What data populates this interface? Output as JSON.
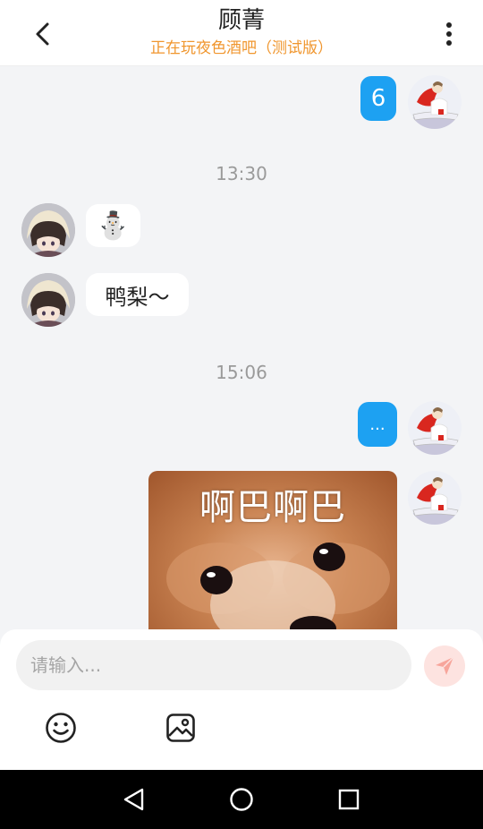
{
  "header": {
    "title": "顾菁",
    "subtitle": "正在玩夜色酒吧（测试版）",
    "back_icon": "chevron-left-icon",
    "more_icon": "more-vertical-icon"
  },
  "messages": {
    "m1": {
      "text": "6",
      "sender": "self"
    },
    "time1": "13:30",
    "m2": {
      "text": "⛄",
      "sender": "friend"
    },
    "m3": {
      "text": "鸭梨～",
      "sender": "friend"
    },
    "time2": "15:06",
    "m4": {
      "text": "...",
      "sender": "self"
    },
    "m5": {
      "sticker_text": "啊巴啊巴",
      "sender": "self"
    }
  },
  "input": {
    "placeholder": "请输入..."
  },
  "toolbar": {
    "emoji_icon": "smiley-icon",
    "image_icon": "image-icon",
    "send_icon": "send-icon"
  },
  "colors": {
    "accent": "#1da1f2",
    "subtitle": "#f0962e",
    "send_bg": "#fde3e0",
    "send_fg": "#f7a59b"
  },
  "navbar": {
    "back_icon": "nav-back-icon",
    "home_icon": "nav-home-icon",
    "recent_icon": "nav-recent-icon"
  }
}
